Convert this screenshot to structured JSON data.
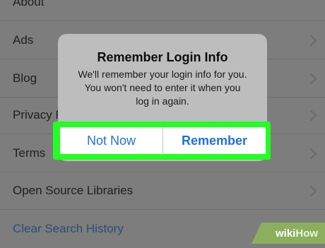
{
  "settings_list": {
    "items": [
      {
        "label": "About"
      },
      {
        "label": "Ads"
      },
      {
        "label": "Blog"
      },
      {
        "label": "Privacy Policy"
      },
      {
        "label": "Terms"
      },
      {
        "label": "Open Source Libraries"
      }
    ],
    "clear_history": "Clear Search History"
  },
  "dialog": {
    "title": "Remember Login Info",
    "message": "We'll remember your login info for you.\nYou won't need to enter it when you\nlog in again.",
    "buttons": {
      "not_now": "Not Now",
      "remember": "Remember"
    }
  },
  "watermark": {
    "text_a": "wiki",
    "text_b": "How"
  },
  "colors": {
    "highlight": "#22ff22",
    "button_text": "#1f72d6",
    "overlay": "#7d7d7d"
  }
}
